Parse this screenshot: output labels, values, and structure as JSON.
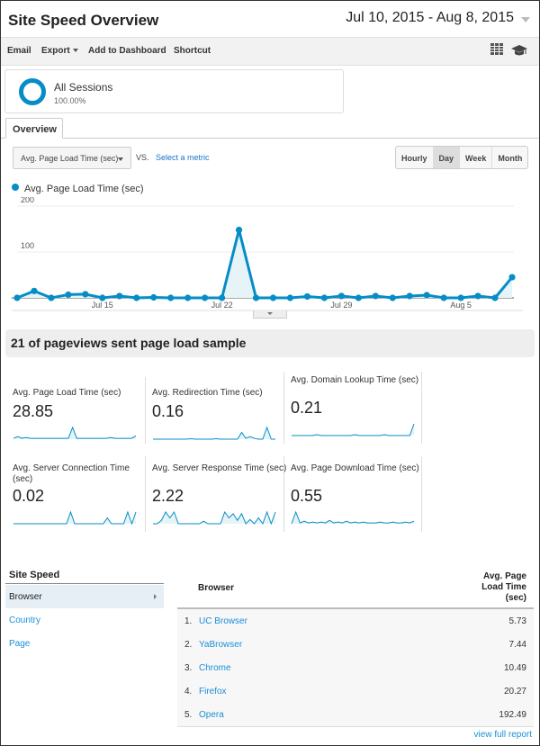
{
  "header": {
    "title": "Site Speed Overview",
    "date_range": "Jul 10, 2015 - Aug 8, 2015"
  },
  "toolbar": {
    "email": "Email",
    "export": "Export",
    "add_to_dashboard": "Add to Dashboard",
    "shortcut": "Shortcut",
    "icons": [
      "grid-icon",
      "graduation-cap-icon"
    ]
  },
  "segment": {
    "name": "All Sessions",
    "percent": "100.00%"
  },
  "tabs": [
    {
      "label": "Overview",
      "active": true
    }
  ],
  "metric_selector": {
    "selected": "Avg. Page Load Time (sec)",
    "vs_label": "VS.",
    "select_metric_link": "Select a metric"
  },
  "granularity": {
    "options": [
      "Hourly",
      "Day",
      "Week",
      "Month"
    ],
    "active": "Day"
  },
  "chart_data": {
    "type": "area",
    "title": "",
    "legend": [
      "Avg. Page Load Time (sec)"
    ],
    "legend_position": "top-left",
    "x": [
      "Jul 10",
      "Jul 11",
      "Jul 12",
      "Jul 13",
      "Jul 14",
      "Jul 15",
      "Jul 16",
      "Jul 17",
      "Jul 18",
      "Jul 19",
      "Jul 20",
      "Jul 21",
      "Jul 22",
      "Jul 23",
      "Jul 24",
      "Jul 25",
      "Jul 26",
      "Jul 27",
      "Jul 28",
      "Jul 29",
      "Jul 30",
      "Jul 31",
      "Aug 1",
      "Aug 2",
      "Aug 3",
      "Aug 4",
      "Aug 5",
      "Aug 6",
      "Aug 7",
      "Aug 8"
    ],
    "x_tick_labels": [
      "Jul 15",
      "Jul 22",
      "Jul 29",
      "Aug 5"
    ],
    "series": [
      {
        "name": "Avg. Page Load Time (sec)",
        "color": "#058dc7",
        "values": [
          0,
          15,
          0,
          7,
          8,
          0,
          4,
          0,
          1,
          0,
          0,
          0,
          0,
          148,
          0,
          0,
          0,
          3,
          0,
          4,
          0,
          4,
          0,
          4,
          6,
          0,
          0,
          4,
          0,
          45
        ]
      }
    ],
    "ylim": [
      0,
      200
    ],
    "y_ticks": [
      100,
      200
    ],
    "grid": true,
    "xlabel": "",
    "ylabel": ""
  },
  "sample_banner": "21 of pageviews sent page load sample",
  "tiles": [
    {
      "label": "Avg. Page Load Time (sec)",
      "value": "28.85",
      "spark": [
        1,
        3,
        1,
        2,
        1,
        1,
        1,
        1,
        1,
        1,
        1,
        1,
        1,
        1,
        14,
        1,
        1,
        1,
        1,
        1,
        1,
        1,
        1,
        2,
        1,
        1,
        1,
        1,
        1,
        4
      ]
    },
    {
      "label": "Avg. Redirection Time (sec)",
      "value": "0.16",
      "spark": [
        0,
        0,
        0,
        0,
        0,
        0,
        0,
        0,
        0,
        0.5,
        0,
        0,
        0,
        0,
        0,
        0.5,
        0,
        0,
        0,
        0,
        0,
        8,
        1,
        3,
        1,
        0,
        0,
        14,
        0,
        0
      ]
    },
    {
      "label": "Avg. Domain Lookup Time (sec)",
      "value": "0.21",
      "spark": [
        0,
        0,
        0,
        0,
        0,
        0,
        1,
        0,
        0,
        0,
        0,
        0,
        0,
        0,
        0,
        1,
        0,
        0,
        0,
        0,
        0,
        0,
        1,
        0,
        0,
        0,
        0,
        0,
        0,
        14
      ]
    },
    {
      "label": "Avg. Server Connection Time (sec)",
      "value": "0.02",
      "spark": [
        0,
        0,
        0,
        0,
        0,
        0,
        0,
        0,
        0,
        0,
        0,
        0,
        0,
        0,
        14,
        0,
        0,
        0,
        0,
        0,
        0,
        0,
        0,
        7,
        0,
        0,
        0,
        0,
        14,
        0,
        14
      ]
    },
    {
      "label": "Avg. Server Response Time (sec)",
      "value": "2.22",
      "spark": [
        0,
        0,
        4,
        14,
        7,
        14,
        0,
        0,
        0,
        0,
        0,
        0,
        3,
        0,
        0,
        0,
        0,
        14,
        7,
        12,
        4,
        12,
        0,
        5,
        0,
        7,
        0,
        14,
        0,
        14
      ]
    },
    {
      "label": "Avg. Page Download Time (sec)",
      "value": "0.55",
      "spark": [
        0,
        14,
        1,
        3,
        1,
        2,
        1,
        2,
        1,
        4,
        1,
        2,
        1,
        3,
        1,
        2,
        1,
        2,
        1,
        1,
        1,
        2,
        1,
        1,
        2,
        1,
        1,
        2,
        1,
        3
      ]
    }
  ],
  "nav": {
    "title": "Site Speed",
    "items": [
      {
        "label": "Browser",
        "active": true
      },
      {
        "label": "Country",
        "active": false
      },
      {
        "label": "Page",
        "active": false
      }
    ]
  },
  "table": {
    "col_dimension": "Browser",
    "col_metric": "Avg. Page Load Time (sec)",
    "col_metric_lines": [
      "Avg. Page",
      "Load Time",
      "(sec)"
    ],
    "rows": [
      {
        "rank": "1.",
        "name": "UC Browser",
        "value": "5.73"
      },
      {
        "rank": "2.",
        "name": "YaBrowser",
        "value": "7.44"
      },
      {
        "rank": "3.",
        "name": "Chrome",
        "value": "10.49"
      },
      {
        "rank": "4.",
        "name": "Firefox",
        "value": "20.27"
      },
      {
        "rank": "5.",
        "name": "Opera",
        "value": "192.49"
      }
    ],
    "view_full_report": "view full report"
  }
}
